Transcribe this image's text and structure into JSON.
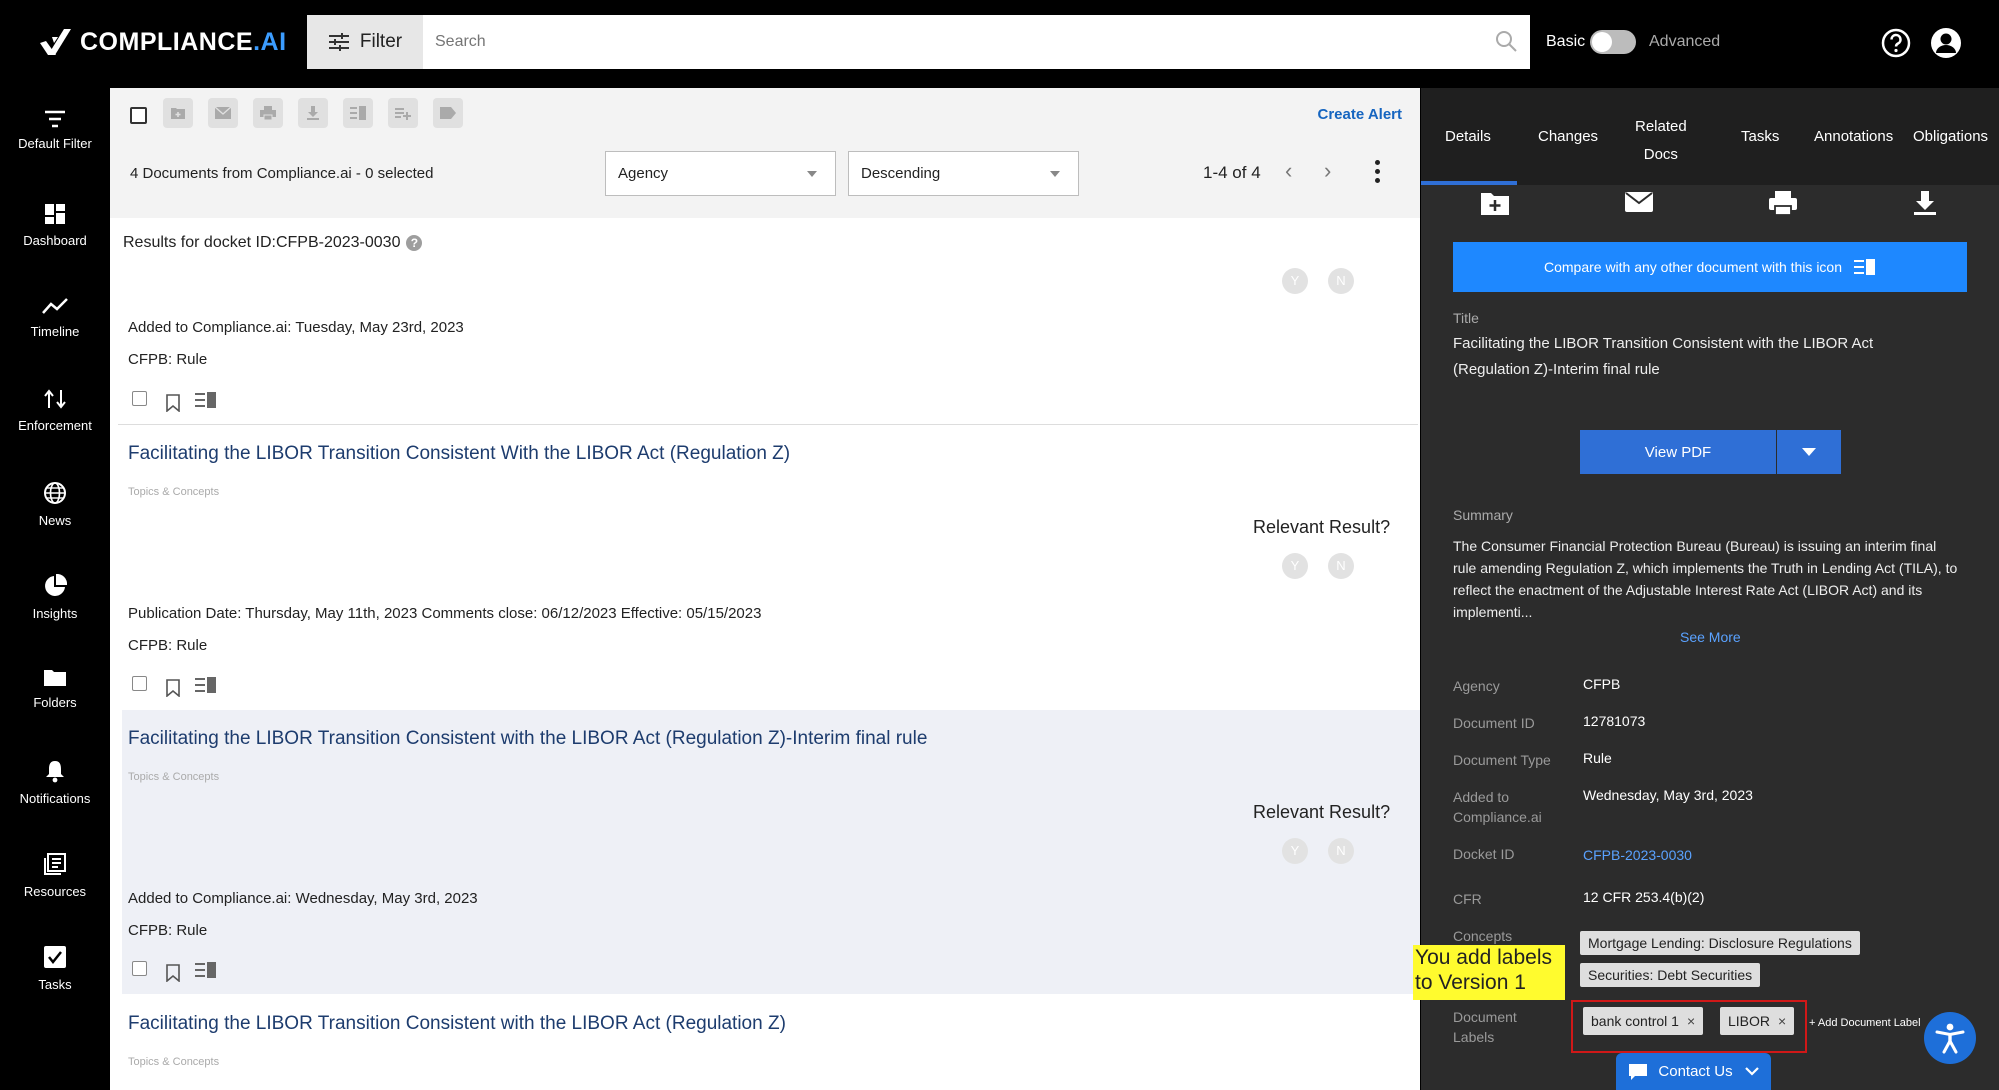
{
  "app": {
    "logo_text": "COMPLIANCE",
    "logo_suffix": ".AI"
  },
  "topbar": {
    "filter_label": "Filter",
    "search_placeholder": "Search",
    "mode_basic": "Basic",
    "mode_advanced": "Advanced"
  },
  "nav": {
    "items": [
      {
        "label": "Default Filter",
        "icon": "filter-icon"
      },
      {
        "label": "Dashboard",
        "icon": "dashboard-icon"
      },
      {
        "label": "Timeline",
        "icon": "timeline-icon"
      },
      {
        "label": "Enforcement",
        "icon": "enforcement-icon"
      },
      {
        "label": "News",
        "icon": "globe-icon"
      },
      {
        "label": "Insights",
        "icon": "pie-chart-icon"
      },
      {
        "label": "Folders",
        "icon": "folder-icon"
      },
      {
        "label": "Notifications",
        "icon": "bell-icon"
      },
      {
        "label": "Resources",
        "icon": "resources-icon"
      },
      {
        "label": "Tasks",
        "icon": "checkbox-icon"
      }
    ]
  },
  "list": {
    "create_alert": "Create Alert",
    "doc_count": "4 Documents from Compliance.ai - 0 selected",
    "sort_field": "Agency",
    "sort_order": "Descending",
    "paging": "1-4 of 4",
    "results_header": "Results for docket ID:CFPB-2023-0030",
    "yes": "Y",
    "no": "N",
    "relevant_label": "Relevant Result?",
    "topics_label": "Topics & Concepts",
    "docs": [
      {
        "meta": "Added to Compliance.ai: Tuesday, May 23rd, 2023",
        "agency_line": "CFPB:  Rule"
      },
      {
        "title": "Facilitating the LIBOR Transition Consistent With the LIBOR Act (Regulation Z)",
        "meta": "Publication Date: Thursday, May 11th, 2023  Comments close:  06/12/2023  Effective:  05/15/2023",
        "agency_line": "CFPB:  Rule"
      },
      {
        "title": "Facilitating the LIBOR Transition Consistent with the LIBOR Act (Regulation Z)-Interim final rule",
        "meta": "Added to Compliance.ai: Wednesday, May 3rd, 2023",
        "agency_line": "CFPB:  Rule"
      },
      {
        "title": "Facilitating the LIBOR Transition Consistent with the LIBOR Act (Regulation Z)"
      }
    ]
  },
  "details": {
    "tabs": [
      "Details",
      "Changes",
      "Related",
      "Docs",
      "Tasks",
      "Annotations",
      "Obligations"
    ],
    "compare_text": "Compare with any other document with this icon",
    "title_label": "Title",
    "title_line1": "Facilitating the LIBOR Transition Consistent with the LIBOR Act",
    "title_line2": "(Regulation Z)-Interim final rule",
    "view_pdf": "View PDF",
    "summary_label": "Summary",
    "summary": "The Consumer Financial Protection Bureau (Bureau) is issuing an interim final rule amending Regulation Z, which implements the Truth in Lending Act (TILA), to reflect the enactment of the Adjustable Interest Rate Act (LIBOR Act) and its implementi...",
    "see_more": "See More",
    "agency_k": "Agency",
    "agency_v": "CFPB",
    "docid_k": "Document ID",
    "docid_v": "12781073",
    "doctype_k": "Document Type",
    "doctype_v": "Rule",
    "added_k1": "Added to",
    "added_k2": "Compliance.ai",
    "added_v": "Wednesday, May 3rd, 2023",
    "docket_k": "Docket ID",
    "docket_v": "CFPB-2023-0030",
    "cfr_k": "CFR",
    "cfr_v": "12 CFR 253.4(b)(2)",
    "concepts_k": "Concepts",
    "concepts": [
      "Mortgage Lending: Disclosure Regulations",
      "Securities: Debt Securities"
    ],
    "labels_k1": "Document",
    "labels_k2": "Labels",
    "labels": [
      "bank control 1",
      "LIBOR"
    ],
    "add_label": "+ Add Document Label",
    "remove_glyph": "×"
  },
  "annotation": {
    "line1": "You add labels",
    "line2": "to Version 1"
  },
  "footer": {
    "contact_us": "Contact Us"
  },
  "colors": {
    "accent": "#2f6fd6",
    "link": "#1d3c6e",
    "panel_bg": "#2c2c2c",
    "highlight": "#d01818",
    "note": "#fffb2e"
  }
}
